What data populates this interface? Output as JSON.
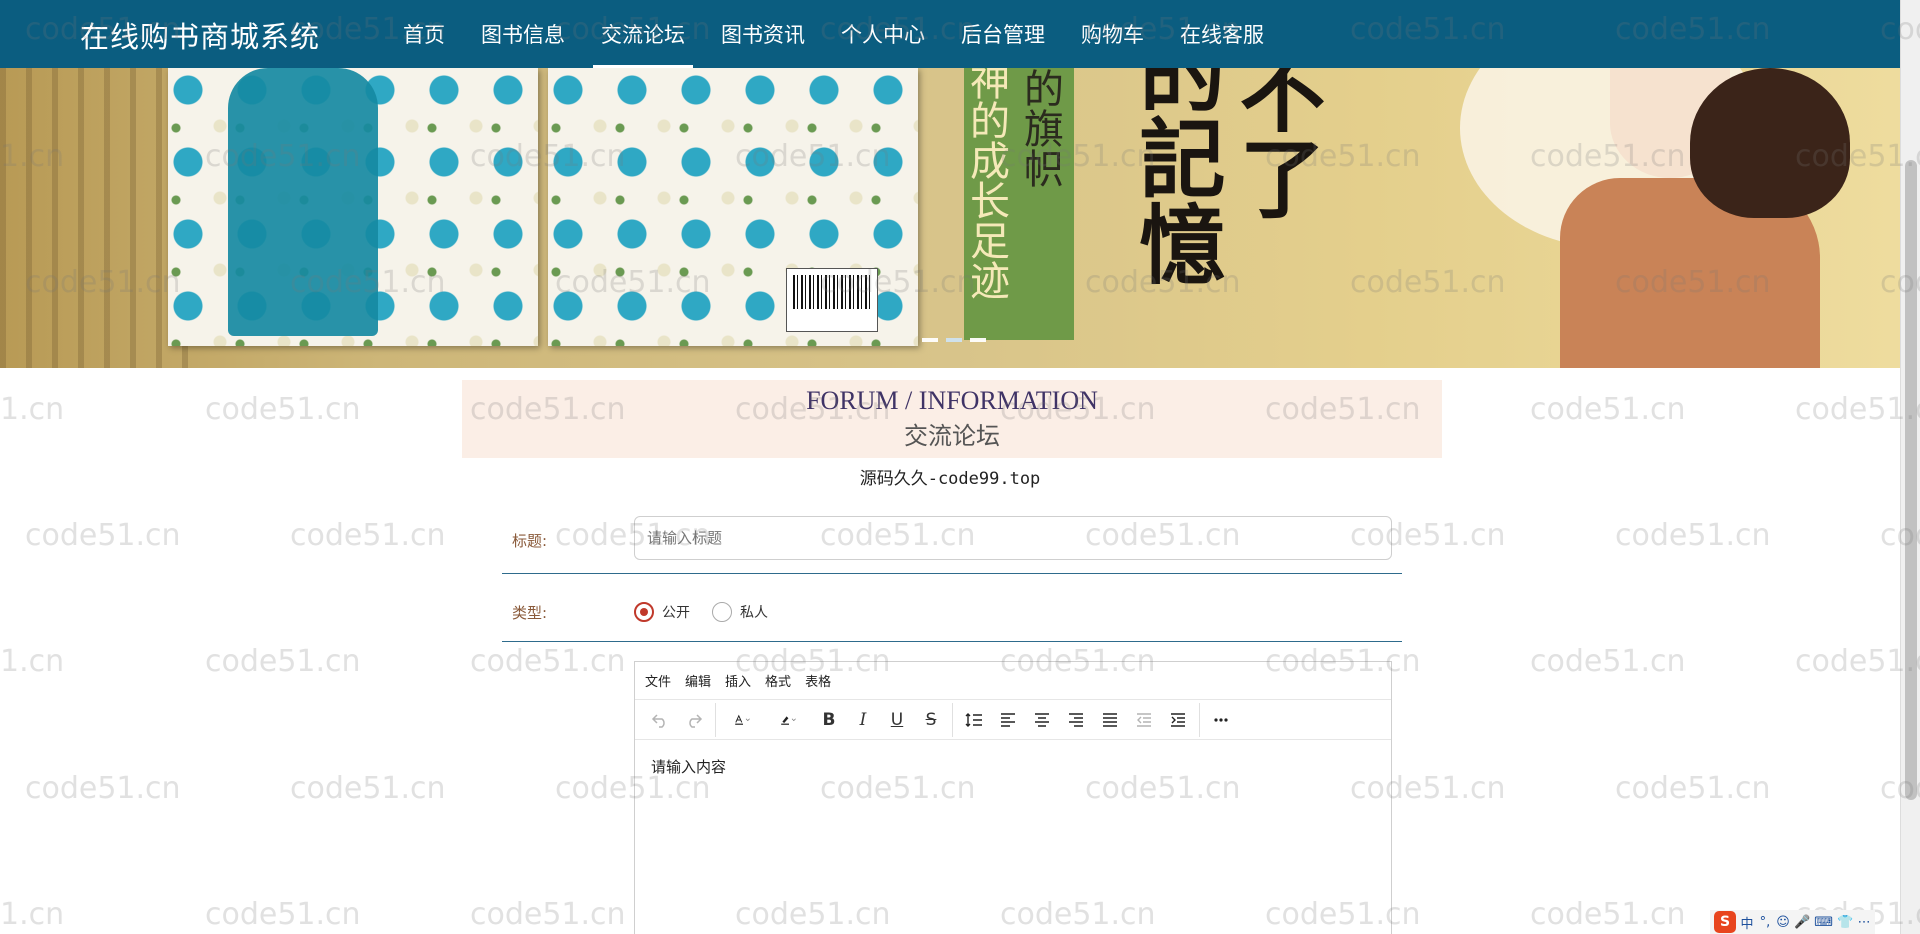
{
  "brand": {
    "title": "在线购书商城系统"
  },
  "nav": {
    "items": [
      {
        "label": "首页"
      },
      {
        "label": "图书信息"
      },
      {
        "label": "交流论坛"
      },
      {
        "label": "图书资讯"
      },
      {
        "label": "个人中心"
      },
      {
        "label": "后台管理"
      },
      {
        "label": "购物车"
      },
      {
        "label": "在线客服"
      }
    ],
    "active": "交流论坛"
  },
  "banner": {
    "spine_text_left": "神的成长足迹",
    "spine_text_right": "的旗帜",
    "calligraphy_left": "的記憶",
    "calligraphy_right": "不了",
    "carousel_dots": 3,
    "carousel_active": 2
  },
  "section": {
    "title_en": "FORUM / INFORMATION",
    "title_zh": "交流论坛",
    "subtitle": "源码久久-code99.top"
  },
  "form": {
    "title_label": "标题:",
    "title_placeholder": "请输入标题",
    "title_value": "",
    "type_label": "类型:",
    "type_options": [
      {
        "label": "公开",
        "checked": true
      },
      {
        "label": "私人",
        "checked": false
      }
    ]
  },
  "editor": {
    "menu": [
      "文件",
      "编辑",
      "插入",
      "格式",
      "表格"
    ],
    "placeholder": "请输入内容",
    "tools": [
      "undo-icon",
      "redo-icon",
      "font-color-icon",
      "highlight-color-icon",
      "bold-icon",
      "italic-icon",
      "underline-icon",
      "strikethrough-icon",
      "line-height-icon",
      "align-left-icon",
      "align-center-icon",
      "align-right-icon",
      "align-justify-icon",
      "outdent-icon",
      "indent-icon",
      "more-icon"
    ]
  },
  "watermark": {
    "text": "code51.cn",
    "text_partial": "1.cn"
  },
  "tray": {
    "logo": "S",
    "items": [
      "中",
      "°,",
      "☺",
      "🎤",
      "⌨",
      "👕",
      "⋯"
    ]
  },
  "colors": {
    "nav_bg": "#0b5d80",
    "title_bg": "#fbeee6",
    "radio_checked": "#c0392b",
    "underline": "#2e6b8c"
  }
}
